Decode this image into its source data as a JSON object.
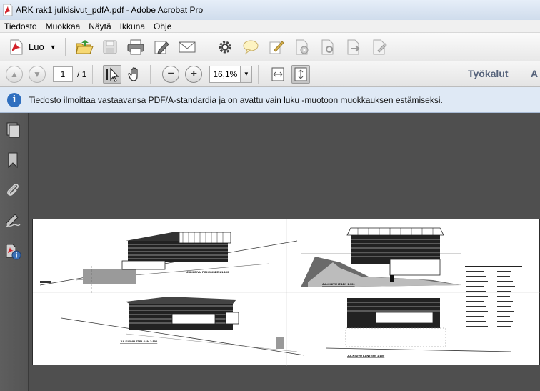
{
  "window": {
    "title": "ARK rak1 julkisivut_pdfA.pdf - Adobe Acrobat Pro"
  },
  "menu": {
    "items": [
      "Tiedosto",
      "Muokkaa",
      "Näytä",
      "Ikkuna",
      "Ohje"
    ]
  },
  "toolbar": {
    "create_label": "Luo",
    "icons": [
      "open-folder-icon",
      "save-icon",
      "print-icon",
      "edit-icon",
      "email-icon",
      "settings-icon",
      "comment-icon",
      "sign-icon",
      "tool-a-icon",
      "tool-b-icon",
      "tool-c-icon",
      "tool-d-icon"
    ]
  },
  "navigation": {
    "current_page": "1",
    "total_pages": "/ 1",
    "zoom": "16,1%",
    "tools_label": "Työkalut",
    "extra_label": "A"
  },
  "infobar": {
    "message": "Tiedosto ilmoittaa vastaavansa PDF/A-standardia ja on avattu vain luku -muotoon muokkauksen estämiseksi."
  },
  "drawing": {
    "labels": {
      "north": "JULKISIVU POHJOISEEN 1:100",
      "east": "JULKISIVU ITÄÄN 1:100",
      "south": "JULKISIVU ETELÄÄN 1:100",
      "west": "JULKISIVU LÄNTEEN 1:100"
    }
  },
  "colors": {
    "accent": "#2f6fbf",
    "infobar_bg": "#dfe9f5",
    "tools_text": "#55627a"
  }
}
